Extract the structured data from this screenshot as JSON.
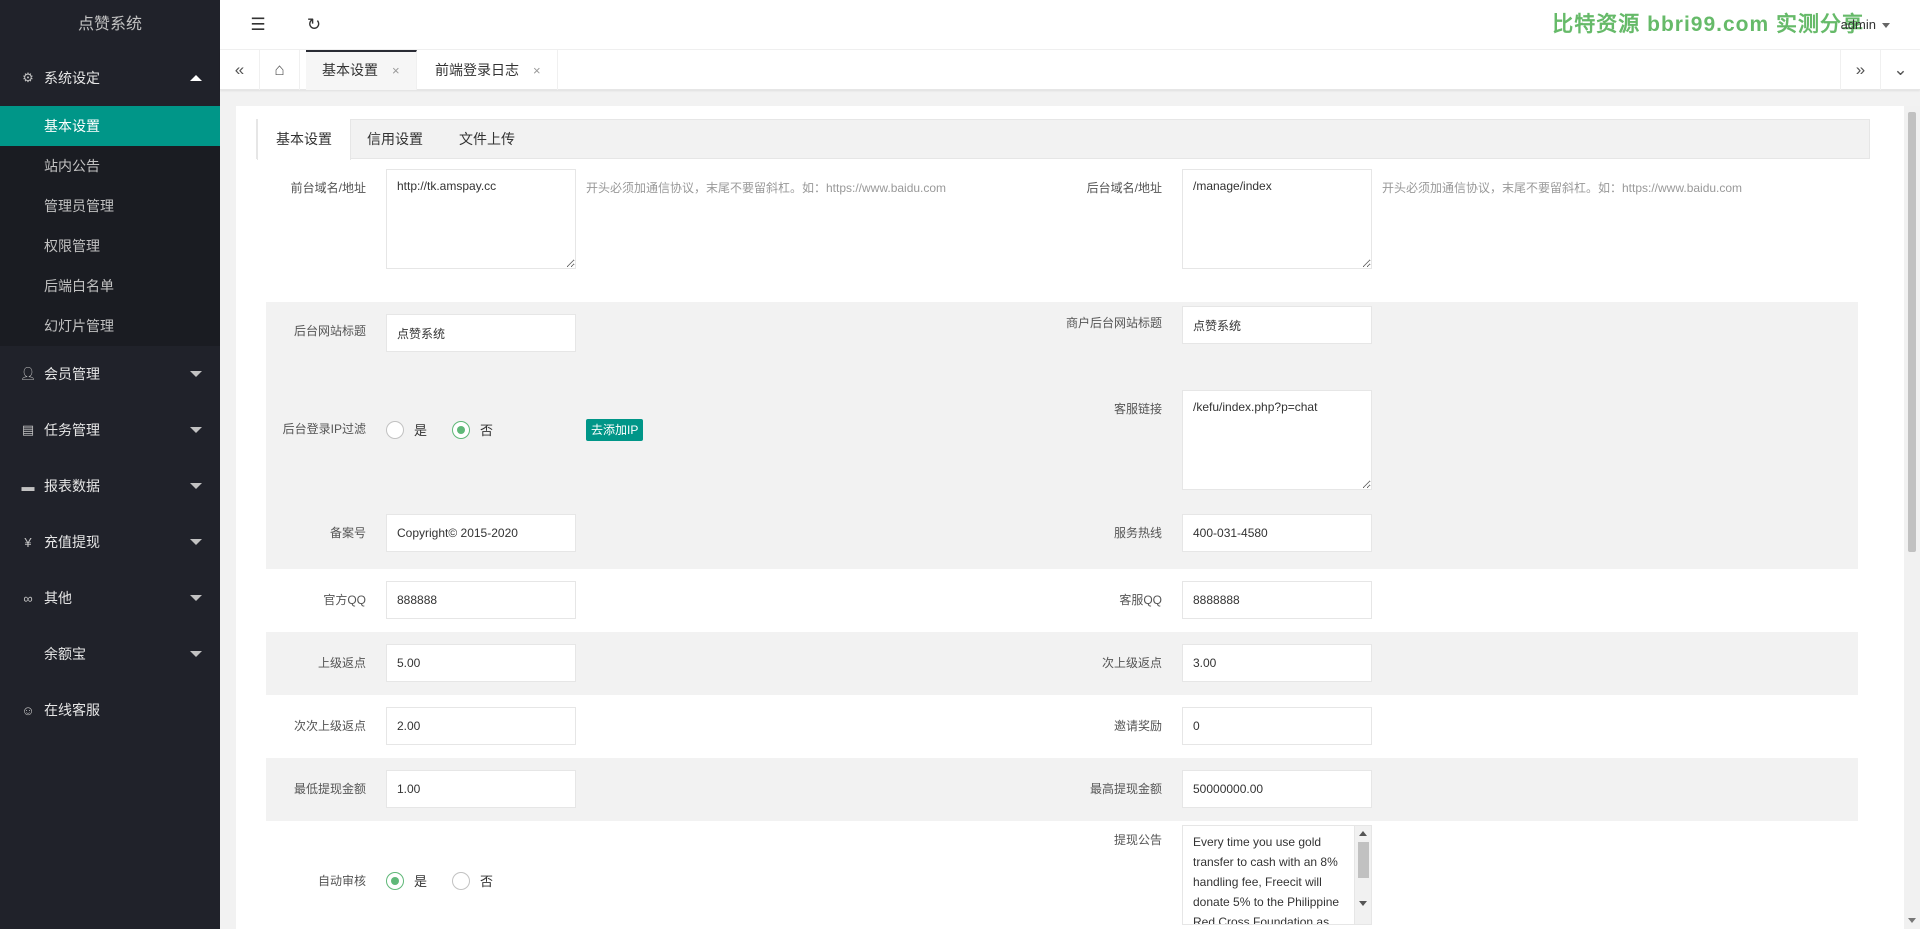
{
  "app": {
    "title": "点赞系统"
  },
  "sidebar": {
    "groups": [
      {
        "label": "系统设定",
        "icon": "gear-icon",
        "expanded": true
      },
      {
        "label": "会员管理",
        "icon": "user-icon"
      },
      {
        "label": "任务管理",
        "icon": "document-icon"
      },
      {
        "label": "报表数据",
        "icon": "monitor-icon"
      },
      {
        "label": "充值提现",
        "icon": "yen-icon"
      },
      {
        "label": "其他",
        "icon": "link-icon"
      },
      {
        "label": "余额宝",
        "icon": ""
      },
      {
        "label": "在线客服",
        "icon": "smile-icon"
      }
    ],
    "sub_items": [
      {
        "label": "基本设置",
        "active": true
      },
      {
        "label": "站内公告"
      },
      {
        "label": "管理员管理"
      },
      {
        "label": "权限管理"
      },
      {
        "label": "后端白名单"
      },
      {
        "label": "幻灯片管理"
      }
    ]
  },
  "header": {
    "watermark": "比特资源 bbri99.com 实测分享",
    "user": "admin"
  },
  "page_tabs": [
    {
      "label": "基本设置",
      "active": true,
      "close": "×"
    },
    {
      "label": "前端登录日志",
      "close": "×"
    }
  ],
  "card_tabs": [
    "基本设置",
    "信用设置",
    "文件上传"
  ],
  "form": {
    "front_domain": {
      "label": "前台域名/地址",
      "value": "http://tk.amspay.cc",
      "hint": "开头必须加通信协议，末尾不要留斜杠。如：https://www.baidu.com"
    },
    "back_domain": {
      "label": "后台域名/地址",
      "value": "/manage/index",
      "hint": "开头必须加通信协议，末尾不要留斜杠。如：https://www.baidu.com"
    },
    "site_title": {
      "label": "后台网站标题",
      "value": "点赞系统"
    },
    "merchant_title": {
      "label": "商户后台网站标题",
      "value": "点赞系统"
    },
    "ip_filter": {
      "label": "后台登录IP过滤",
      "yes": "是",
      "no": "否",
      "selected": "否",
      "button": "去添加IP"
    },
    "service_link": {
      "label": "客服链接",
      "value": "/kefu/index.php?p=chat"
    },
    "icp": {
      "label": "备案号",
      "value": "Copyright© 2015-2020"
    },
    "hotline": {
      "label": "服务热线",
      "value": "400-031-4580"
    },
    "official_qq": {
      "label": "官方QQ",
      "value": "888888"
    },
    "service_qq": {
      "label": "客服QQ",
      "value": "8888888"
    },
    "upper_rebate": {
      "label": "上级返点",
      "value": "5.00"
    },
    "second_rebate": {
      "label": "次上级返点",
      "value": "3.00"
    },
    "third_rebate": {
      "label": "次次上级返点",
      "value": "2.00"
    },
    "invite_reward": {
      "label": "邀请奖励",
      "value": "0"
    },
    "min_withdraw": {
      "label": "最低提现金额",
      "value": "1.00"
    },
    "max_withdraw": {
      "label": "最高提现金额",
      "value": "50000000.00"
    },
    "auto_review": {
      "label": "自动审核",
      "yes": "是",
      "no": "否",
      "selected": "是"
    },
    "withdraw_notice": {
      "label": "提现公告",
      "value": "Every time you use gold transfer to cash with an 8% handling fee, Freecit will donate 5% to the Philippine Red Cross Foundation as"
    }
  }
}
